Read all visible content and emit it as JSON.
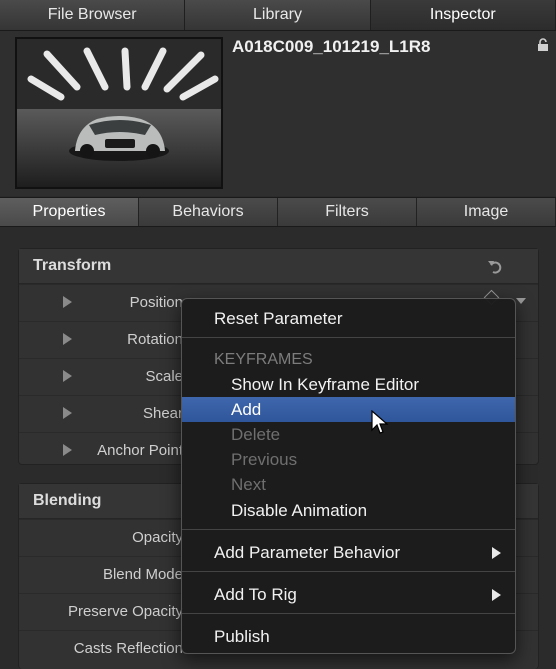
{
  "top_tabs": [
    {
      "label": "File Browser",
      "active": false
    },
    {
      "label": "Library",
      "active": false
    },
    {
      "label": "Inspector",
      "active": true
    }
  ],
  "clip": {
    "name": "A018C009_101219_L1R8"
  },
  "sub_tabs": [
    {
      "label": "Properties",
      "active": true
    },
    {
      "label": "Behaviors",
      "active": false
    },
    {
      "label": "Filters",
      "active": false
    },
    {
      "label": "Image",
      "active": false
    }
  ],
  "transform": {
    "title": "Transform",
    "rows": [
      "Position",
      "Rotation",
      "Scale",
      "Shear",
      "Anchor Point"
    ]
  },
  "blending": {
    "title": "Blending",
    "rows": [
      "Opacity",
      "Blend Mode",
      "Preserve Opacity",
      "Casts Reflection"
    ]
  },
  "context_menu": {
    "reset": "Reset Parameter",
    "keyframes_header": "KEYFRAMES",
    "show_in_editor": "Show In Keyframe Editor",
    "add": "Add",
    "delete": "Delete",
    "previous": "Previous",
    "next": "Next",
    "disable_animation": "Disable Animation",
    "add_parameter_behavior": "Add Parameter Behavior",
    "add_to_rig": "Add To Rig",
    "publish": "Publish"
  },
  "colors": {
    "highlight": "#2f569a",
    "background": "#2b2b2b",
    "panel": "#323232"
  }
}
